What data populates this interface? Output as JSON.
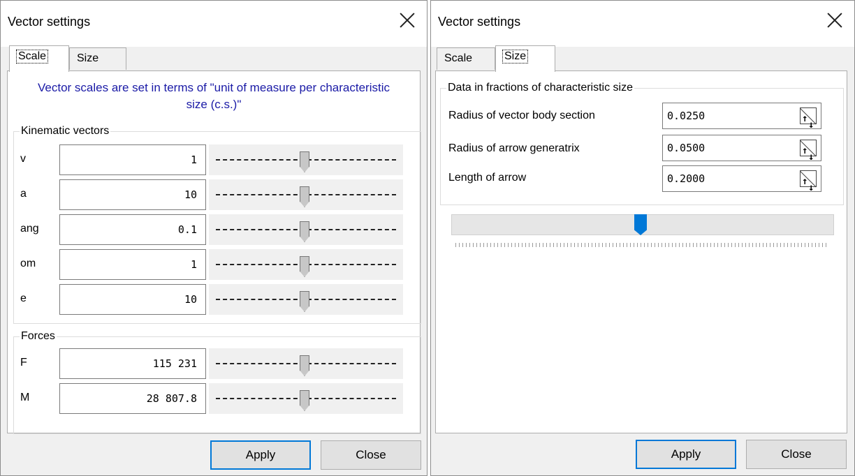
{
  "left": {
    "title": "Vector settings",
    "tabs": [
      "Scale",
      "Size"
    ],
    "info": "Vector scales are set in terms of \"unit of measure per characteristic size (c.s.)\"",
    "kinematic": {
      "legend": "Kinematic vectors",
      "rows": [
        {
          "label": "v",
          "value": "1"
        },
        {
          "label": "a",
          "value": "10"
        },
        {
          "label": "ang",
          "value": "0.1"
        },
        {
          "label": "om",
          "value": "1"
        },
        {
          "label": "e",
          "value": "10"
        }
      ]
    },
    "forces": {
      "legend": "Forces",
      "rows": [
        {
          "label": "F",
          "value": "115 231"
        },
        {
          "label": "M",
          "value": "28 807.8"
        }
      ]
    },
    "apply": "Apply",
    "close": "Close"
  },
  "right": {
    "title": "Vector settings",
    "tabs": [
      "Scale",
      "Size"
    ],
    "group_legend": "Data in fractions of characteristic size",
    "rows": [
      {
        "label": "Radius of vector body section",
        "value": "0.0250"
      },
      {
        "label": "Radius of arrow generatrix",
        "value": "0.0500"
      },
      {
        "label": "Length of arrow",
        "value": "0.2000"
      }
    ],
    "slider_level": 0.5,
    "apply": "Apply",
    "close": "Close"
  },
  "colors": {
    "accent": "#0078d7",
    "info_text": "#1a1aa6"
  },
  "icons": [
    "close-icon",
    "spin-icon",
    "slider-thumb"
  ]
}
